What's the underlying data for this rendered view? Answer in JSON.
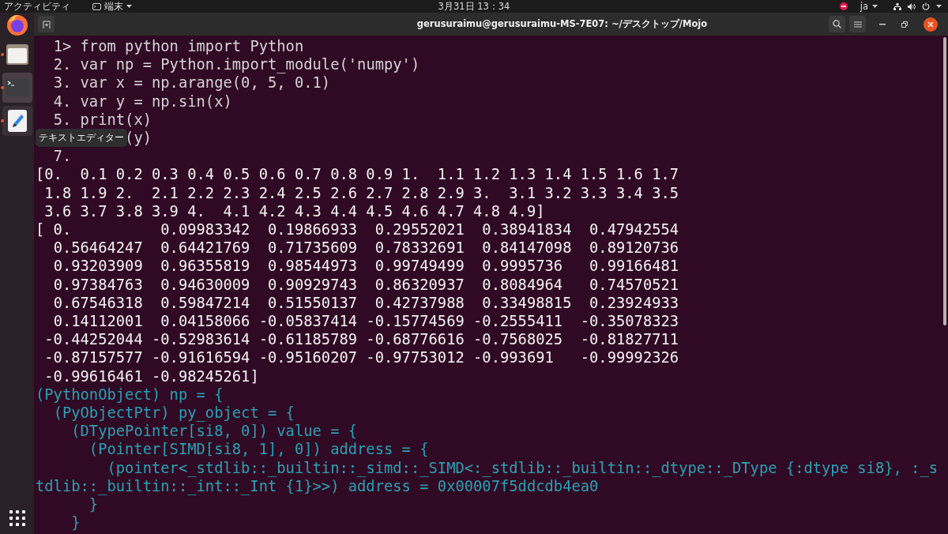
{
  "top_bar": {
    "activities": "アクティビティ",
    "app_menu": "端末",
    "clock": "3月31日 13：34",
    "input_method": "ja"
  },
  "dock": {
    "items": [
      {
        "kind": "browser",
        "running": false,
        "selected": false,
        "hovered": false
      },
      {
        "kind": "files",
        "running": true,
        "selected": false,
        "hovered": false
      },
      {
        "kind": "terminal",
        "running": true,
        "selected": true,
        "hovered": false
      },
      {
        "kind": "editor",
        "running": true,
        "selected": false,
        "hovered": true
      }
    ],
    "tooltip": "テキストエディター"
  },
  "window": {
    "title": "gerusuraimu@gerusuraimu-MS-7E07: ~/デスクトップ/Mojo"
  },
  "terminal": {
    "lines": [
      {
        "kind": "input",
        "text": "  1> from python import Python"
      },
      {
        "kind": "input",
        "text": "  2. var np = Python.import_module('numpy')"
      },
      {
        "kind": "input",
        "text": "  3. var x = np.arange(0, 5, 0.1)"
      },
      {
        "kind": "input",
        "text": "  4. var y = np.sin(x)"
      },
      {
        "kind": "input",
        "text": "  5. print(x)"
      },
      {
        "kind": "input",
        "text": "          (y)"
      },
      {
        "kind": "input",
        "text": "  7."
      },
      {
        "kind": "output",
        "text": "[0.  0.1 0.2 0.3 0.4 0.5 0.6 0.7 0.8 0.9 1.  1.1 1.2 1.3 1.4 1.5 1.6 1.7"
      },
      {
        "kind": "output",
        "text": " 1.8 1.9 2.  2.1 2.2 2.3 2.4 2.5 2.6 2.7 2.8 2.9 3.  3.1 3.2 3.3 3.4 3.5"
      },
      {
        "kind": "output",
        "text": " 3.6 3.7 3.8 3.9 4.  4.1 4.2 4.3 4.4 4.5 4.6 4.7 4.8 4.9]"
      },
      {
        "kind": "output",
        "text": "[ 0.          0.09983342  0.19866933  0.29552021  0.38941834  0.47942554"
      },
      {
        "kind": "output",
        "text": "  0.56464247  0.64421769  0.71735609  0.78332691  0.84147098  0.89120736"
      },
      {
        "kind": "output",
        "text": "  0.93203909  0.96355819  0.98544973  0.99749499  0.9995736   0.99166481"
      },
      {
        "kind": "output",
        "text": "  0.97384763  0.94630009  0.90929743  0.86320937  0.8084964   0.74570521"
      },
      {
        "kind": "output",
        "text": "  0.67546318  0.59847214  0.51550137  0.42737988  0.33498815  0.23924933"
      },
      {
        "kind": "output",
        "text": "  0.14112001  0.04158066 -0.05837414 -0.15774569 -0.2555411  -0.35078323"
      },
      {
        "kind": "output",
        "text": " -0.44252044 -0.52983614 -0.61185789 -0.68776616 -0.7568025  -0.81827711"
      },
      {
        "kind": "output",
        "text": " -0.87157577 -0.91616594 -0.95160207 -0.97753012 -0.993691   -0.99992326"
      },
      {
        "kind": "output",
        "text": " -0.99616461 -0.98245261]"
      },
      {
        "kind": "debug",
        "text": "(PythonObject) np = {"
      },
      {
        "kind": "debug",
        "text": "  (PyObjectPtr) py_object = {"
      },
      {
        "kind": "debug",
        "text": "    (DTypePointer[si8, 0]) value = {"
      },
      {
        "kind": "debug",
        "text": "      (Pointer[SIMD[si8, 1], 0]) address = {"
      },
      {
        "kind": "debug",
        "text": "        (pointer<_stdlib::_builtin::_simd::_SIMD<:_stdlib::_builtin::_dtype::_DType {:dtype si8}, :_s"
      },
      {
        "kind": "debug",
        "text": "tdlib::_builtin::_int::_Int {1}>>) address = 0x00007f5ddcdb4ea0"
      },
      {
        "kind": "debug",
        "text": "      }"
      },
      {
        "kind": "debug",
        "text": "    }"
      }
    ]
  }
}
